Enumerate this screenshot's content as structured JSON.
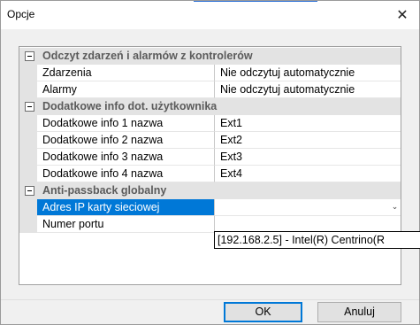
{
  "window": {
    "title": "Opcje",
    "close_glyph": "✕"
  },
  "grid": {
    "categories": [
      {
        "label": "Odczyt zdarzeń i alarmów z kontrolerów",
        "properties": [
          {
            "name": "Zdarzenia",
            "value": "Nie odczytuj automatycznie"
          },
          {
            "name": "Alarmy",
            "value": "Nie odczytuj automatycznie"
          }
        ]
      },
      {
        "label": "Dodatkowe info dot. użytkownika",
        "properties": [
          {
            "name": "Dodatkowe info 1 nazwa",
            "value": "Ext1"
          },
          {
            "name": "Dodatkowe info 2 nazwa",
            "value": "Ext2"
          },
          {
            "name": "Dodatkowe info 3 nazwa",
            "value": "Ext3"
          },
          {
            "name": "Dodatkowe info 4 nazwa",
            "value": "Ext4"
          }
        ]
      },
      {
        "label": "Anti-passback globalny",
        "properties": [
          {
            "name": "Adres IP karty sieciowej",
            "value": "",
            "selected": true
          },
          {
            "name": "Numer portu",
            "value": ""
          }
        ]
      }
    ]
  },
  "dropdown": {
    "open_option": "[192.168.2.5] - Intel(R) Centrino(R",
    "arrow_glyph": "⌄"
  },
  "buttons": {
    "ok_label": "OK",
    "cancel_label": "Anuluj"
  },
  "colors": {
    "selection": "#0078d7",
    "category_bg": "#e3e3e3",
    "category_text": "#5b5b5b"
  }
}
